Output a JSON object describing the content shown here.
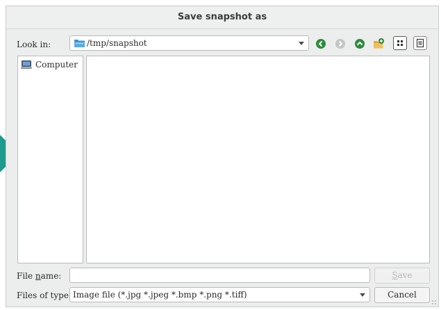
{
  "dialog": {
    "title": "Save snapshot as"
  },
  "look_in": {
    "label_prefix": "Look in:",
    "path": "/tmp/snapshot",
    "folder_color": "#3d8fd1"
  },
  "toolbar": {
    "back_icon": "back-arrow-icon",
    "forward_icon": "forward-arrow-icon",
    "up_icon": "up-arrow-icon",
    "new_folder_icon": "new-folder-icon",
    "detail_view_icon": "detail-view-icon",
    "list_view_icon": "list-view-icon",
    "accent": "#2e8b3c"
  },
  "sidebar": {
    "items": [
      {
        "label": "Computer",
        "icon": "computer-icon"
      }
    ]
  },
  "file_name": {
    "label_pre": "File ",
    "label_underlined": "n",
    "label_post": "ame:",
    "value": ""
  },
  "file_type": {
    "label": "Files of type:",
    "selected": "Image file (*.jpg *.jpeg *.bmp *.png *.tiff)"
  },
  "buttons": {
    "save_underlined": "S",
    "save_rest": "ave",
    "cancel": "Cancel"
  },
  "colors": {
    "teal_marker": "#1e9a8e"
  }
}
